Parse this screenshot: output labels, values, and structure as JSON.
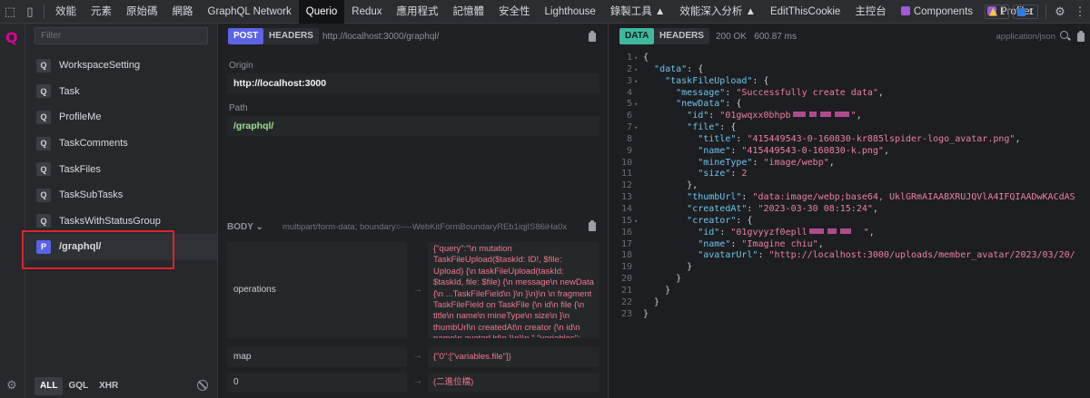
{
  "devtools": {
    "tabs": [
      {
        "label": "效能"
      },
      {
        "label": "元素"
      },
      {
        "label": "原始碼"
      },
      {
        "label": "網路"
      },
      {
        "label": "GraphQL Network"
      },
      {
        "label": "Querio"
      },
      {
        "label": "Redux"
      },
      {
        "label": "應用程式"
      },
      {
        "label": "記憶體"
      },
      {
        "label": "安全性"
      },
      {
        "label": "Lighthouse"
      },
      {
        "label": "錄製工具 ▲"
      },
      {
        "label": "效能深入分析 ▲"
      },
      {
        "label": "EditThisCookie"
      },
      {
        "label": "主控台"
      },
      {
        "label": "Components"
      },
      {
        "label": "Profiler"
      }
    ],
    "active_tab": "Querio",
    "warnings_count": "1",
    "messages_count": "1"
  },
  "sidebar": {
    "filter_placeholder": "Filter",
    "requests": [
      {
        "kind": "Q",
        "name": "WorkspaceSetting"
      },
      {
        "kind": "Q",
        "name": "Task"
      },
      {
        "kind": "Q",
        "name": "ProfileMe"
      },
      {
        "kind": "Q",
        "name": "TaskComments"
      },
      {
        "kind": "Q",
        "name": "TaskFiles"
      },
      {
        "kind": "Q",
        "name": "TaskSubTasks"
      },
      {
        "kind": "Q",
        "name": "TasksWithStatusGroup"
      },
      {
        "kind": "P",
        "name": "/graphql/"
      }
    ],
    "footer_tabs": [
      {
        "label": "ALL"
      },
      {
        "label": "GQL"
      },
      {
        "label": "XHR"
      }
    ]
  },
  "request": {
    "method": "POST",
    "headers_tab": "HEADERS",
    "url": "http://localhost:3000/graphql/",
    "origin_label": "Origin",
    "origin_value": "http://localhost:3000",
    "path_label": "Path",
    "path_value": "/graphql/",
    "body_label": "BODY",
    "content_type": "multipart/form-data; boundary=----WebKitFormBoundaryREb1iqjIS86iHa0x",
    "params": [
      {
        "key": "operations",
        "value": "{\"query\":\"\\n mutation TaskFileUpload($taskId: ID!, $file: Upload) {\\n taskFileUpload(taskId: $taskId, file: $file) {\\n message\\n newData {\\n ...TaskFileField\\n }\\n }\\n}\\n \\n fragment TaskFileField on TaskFile {\\n id\\n file {\\n title\\n name\\n mineType\\n size\\n }\\n thumbUrl\\n createdAt\\n creator {\\n id\\n name\\n avatarUrl\\n }\\n}\\n \",\"variables\":{\"taskId\":\"01gwm8462mg0kfs9cnyjn6f5db\",\"file\":null}}"
      },
      {
        "key": "map",
        "value": "{\"0\":[\"variables.file\"]}"
      },
      {
        "key": "0",
        "value": "(二進位檔)"
      }
    ]
  },
  "response": {
    "data_tab": "DATA",
    "headers_tab": "HEADERS",
    "status": "200 OK",
    "time": "600.87 ms",
    "mime": "application/json"
  }
}
